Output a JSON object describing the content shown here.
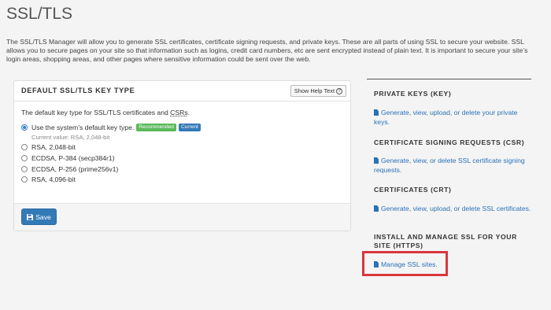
{
  "page": {
    "title": "SSL/TLS",
    "intro": "The SSL/TLS Manager will allow you to generate SSL certificates, certificate signing requests, and private keys. These are all parts of using SSL to secure your website. SSL allows you to secure pages on your site so that information such as logins, credit card numbers, etc are sent encrypted instead of plain text. It is important to secure your site’s login areas, shopping areas, and other pages where sensitive information could be sent over the web."
  },
  "panel": {
    "title": "DEFAULT SSL/TLS KEY TYPE",
    "help_label": "Show Help Text",
    "help_icon": "question-circle-icon",
    "desc_prefix": "The default key type for SSL/TLS certificates and ",
    "desc_abbr": "CSRs",
    "desc_suffix": ".",
    "options": [
      {
        "label": "Use the system’s default key type.",
        "checked": true,
        "badges": [
          "Recommended",
          "Current"
        ]
      },
      {
        "label": "RSA, 2,048-bit",
        "checked": false
      },
      {
        "label": "ECDSA, P-384 (secp384r1)",
        "checked": false
      },
      {
        "label": "ECDSA, P-256 (prime256v1)",
        "checked": false
      },
      {
        "label": "RSA, 4,096-bit",
        "checked": false
      }
    ],
    "current_value": "Current value: RSA, 2,048-bit",
    "save_label": "Save",
    "save_icon": "floppy-disk-icon"
  },
  "sidebar": {
    "sections": [
      {
        "heading": "PRIVATE KEYS (KEY)",
        "link": "Generate, view, upload, or delete your private keys."
      },
      {
        "heading": "CERTIFICATE SIGNING REQUESTS (CSR)",
        "link": "Generate, view, or delete SSL certificate signing requests."
      },
      {
        "heading": "CERTIFICATES (CRT)",
        "link": "Generate, view, upload, or delete SSL certificates."
      },
      {
        "heading": "INSTALL AND MANAGE SSL FOR YOUR SITE (HTTPS)",
        "link": "Manage SSL sites."
      }
    ]
  },
  "colors": {
    "link": "#2a72b8",
    "recommended_badge": "#5cb85c",
    "current_badge": "#337ab7",
    "highlight": "#d9363e"
  }
}
